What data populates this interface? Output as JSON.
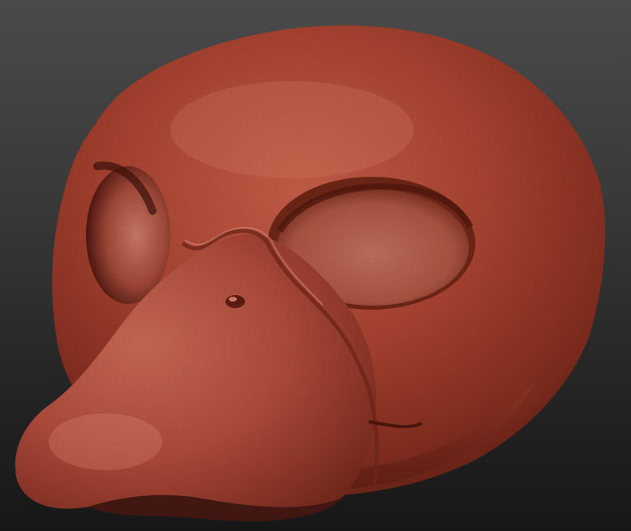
{
  "scene": {
    "subject": "duck-head-sculpt",
    "colors": {
      "background_top": "#4a4a4a",
      "background_bottom": "#171717",
      "clay_base": "#9e3a2a",
      "clay_light": "#c96a55",
      "clay_dark": "#5a1c12",
      "clay_shadow": "#3a100a"
    }
  }
}
